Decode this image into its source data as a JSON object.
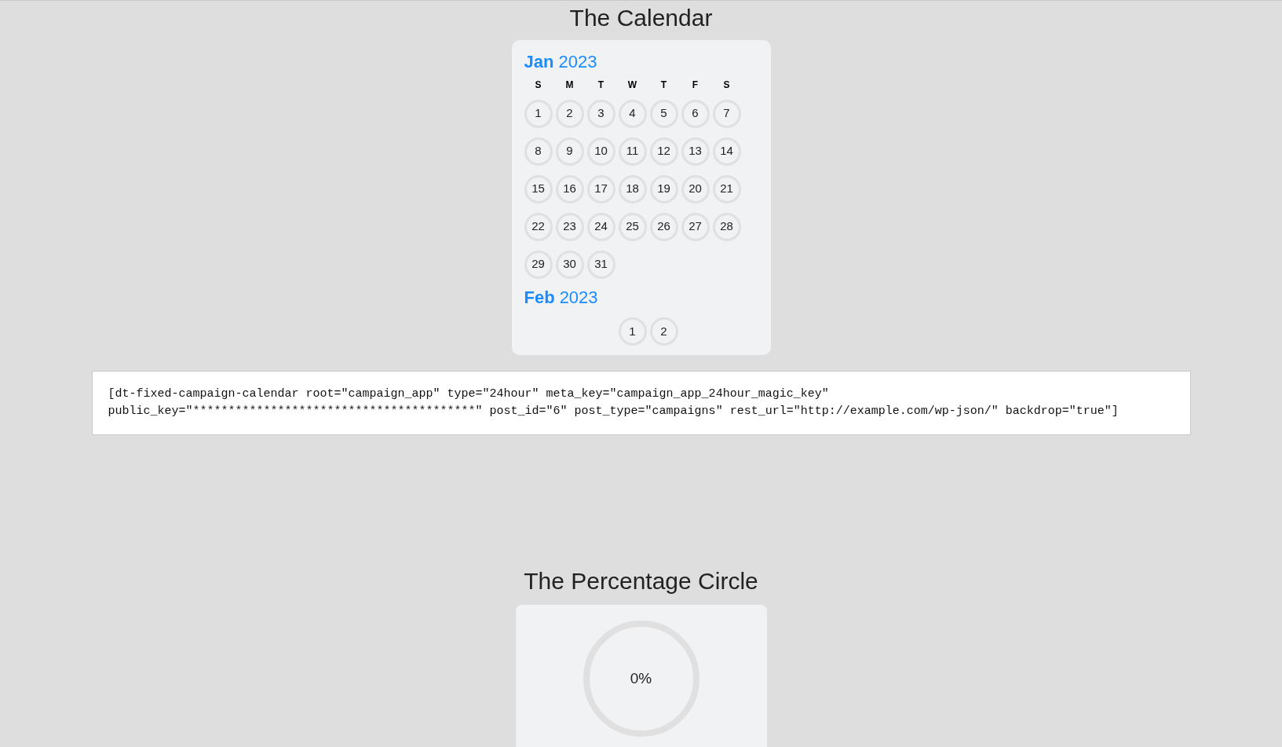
{
  "calendar_section": {
    "title": "The Calendar",
    "weekdays": [
      "S",
      "M",
      "T",
      "W",
      "T",
      "F",
      "S"
    ],
    "months": [
      {
        "month": "Jan",
        "year": "2023",
        "days": [
          "1",
          "2",
          "3",
          "4",
          "5",
          "6",
          "7",
          "8",
          "9",
          "10",
          "11",
          "12",
          "13",
          "14",
          "15",
          "16",
          "17",
          "18",
          "19",
          "20",
          "21",
          "22",
          "23",
          "24",
          "25",
          "26",
          "27",
          "28",
          "29",
          "30",
          "31"
        ]
      },
      {
        "month": "Feb",
        "year": "2023",
        "days": [
          "1",
          "2"
        ]
      }
    ]
  },
  "shortcode": "[dt-fixed-campaign-calendar root=\"campaign_app\" type=\"24hour\" meta_key=\"campaign_app_24hour_magic_key\" public_key=\"****************************************\" post_id=\"6\" post_type=\"campaigns\" rest_url=\"http://example.com/wp-json/\" backdrop=\"true\"]",
  "percentage_section": {
    "title": "The Percentage Circle",
    "reading": "0%"
  }
}
